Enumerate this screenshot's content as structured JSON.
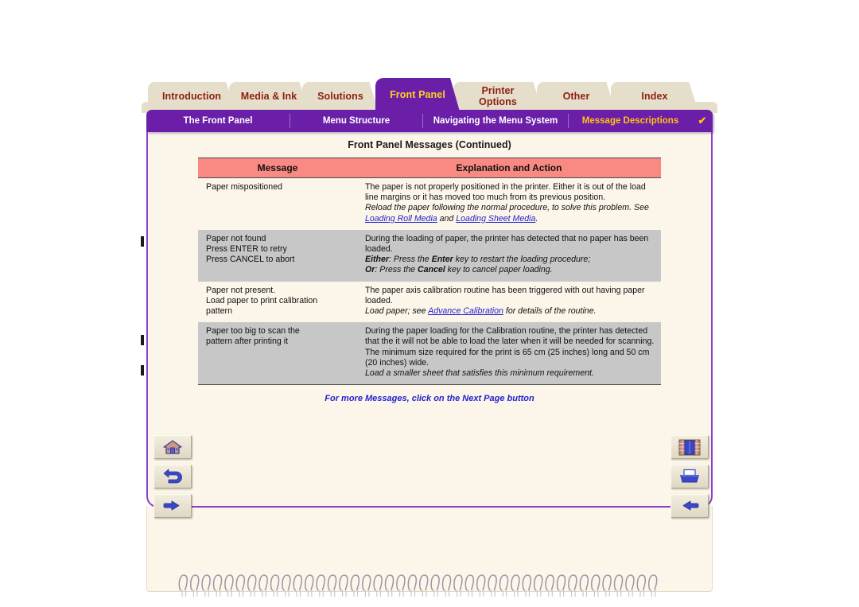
{
  "colors": {
    "tab_bg": "#E5DECB",
    "tab_text": "#8D1F10",
    "active_tab_bg": "#6B1FA8",
    "active_tab_text": "#FFD21E",
    "subnav_bg": "#6B1FA8",
    "subnav_current": "#FFC20E",
    "page_bg": "#FCF6EA",
    "page_border": "#8E3FC9",
    "table_header_bg": "#F98983",
    "row_alt_bg": "#C7C7C7",
    "link": "#2222CC"
  },
  "tabs": [
    {
      "label": "Introduction",
      "active": false
    },
    {
      "label": "Media & Ink",
      "active": false
    },
    {
      "label": "Solutions",
      "active": false
    },
    {
      "label": "Front Panel",
      "active": true
    },
    {
      "label": "Printer Options",
      "line1": "Printer",
      "line2": "Options",
      "active": false
    },
    {
      "label": "Other",
      "active": false
    },
    {
      "label": "Index",
      "active": false
    }
  ],
  "subnav": {
    "items": [
      {
        "label": "The Front Panel",
        "current": false
      },
      {
        "label": "Menu Structure",
        "current": false
      },
      {
        "label": "Navigating the Menu System",
        "current": false
      },
      {
        "label": "Message Descriptions",
        "current": true
      }
    ],
    "check_glyph": "✔"
  },
  "page": {
    "title": "Front Panel Messages (Continued)",
    "footer_note": "For more Messages, click on the Next Page button"
  },
  "table": {
    "headers": [
      "Message",
      "Explanation and Action"
    ],
    "rows": [
      {
        "shade": "even",
        "message": "Paper mispositioned",
        "explanation_plain": "The paper is not properly positioned in the printer. Either it is out of the load line margins or it has moved too much from its previous position.",
        "explanation_italic_pre": "Reload the paper following the normal procedure, to solve this problem. See ",
        "link1": "Loading Roll Media",
        "explanation_italic_mid": " and ",
        "link2": "Loading Sheet Media",
        "explanation_italic_post": "."
      },
      {
        "shade": "odd",
        "message_lines": [
          "Paper not found",
          "Press ENTER to retry",
          "Press CANCEL to abort"
        ],
        "explanation_plain": "During the loading of paper, the printer has detected that no paper has been loaded.",
        "either_label": "Either",
        "either_text_a": ": Press the ",
        "either_key": "Enter",
        "either_text_b": " key to restart the loading procedure;",
        "or_label": "Or",
        "or_text_a": ": Press the ",
        "or_key": "Cancel",
        "or_text_b": " key to cancel paper loading."
      },
      {
        "shade": "even",
        "message_lines": [
          "Paper not present.",
          "Load paper to print calibration",
          "pattern"
        ],
        "explanation_plain": "The paper axis calibration routine has been triggered with out having paper loaded.",
        "explanation_italic_pre": "Load paper; see ",
        "link1": "Advance Calibration",
        "explanation_italic_post": " for details of the routine."
      },
      {
        "shade": "odd",
        "message_lines": [
          "Paper too big to scan the",
          "pattern after printing it"
        ],
        "explanation_plain": "During the paper loading for the Calibration routine, the printer has detected that the it will not be able to load the later when it will be needed for scanning. The minimum size required for the print is 65 cm (25 inches) long and 50 cm (20 inches) wide.",
        "explanation_italic_pre": "Load a smaller sheet that satisfies this minimum requirement."
      }
    ]
  },
  "buttons": {
    "left": [
      {
        "name": "home-button",
        "icon": "home-icon"
      },
      {
        "name": "back-button",
        "icon": "back-arrow-icon"
      },
      {
        "name": "next-page-button",
        "icon": "pointing-hand-icon"
      }
    ],
    "right": [
      {
        "name": "bookshelf-button",
        "icon": "bookcase-icon"
      },
      {
        "name": "print-button",
        "icon": "printer-icon"
      },
      {
        "name": "previous-page-button",
        "icon": "pointing-hand-left-icon"
      }
    ]
  }
}
